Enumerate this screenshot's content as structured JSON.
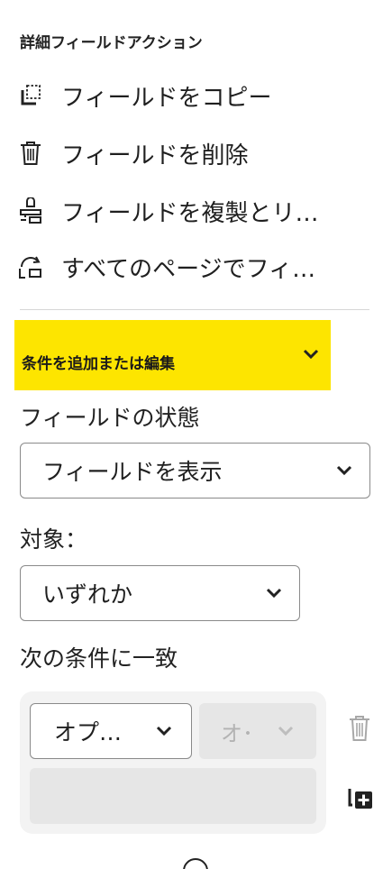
{
  "advanced_actions": {
    "heading": "詳細フィールドアクション",
    "items": [
      {
        "label": "フィールドをコピー",
        "icon": "copy-icon"
      },
      {
        "label": "フィールドを削除",
        "icon": "trash-icon"
      },
      {
        "label": "フィールドを複製とリ…",
        "icon": "duplicate-stamp-icon"
      },
      {
        "label": "すべてのページでフィ…",
        "icon": "all-pages-sync-icon"
      }
    ]
  },
  "conditions": {
    "header_label": "条件を追加または編集",
    "header_color": "#fde500",
    "field_state_label": "フィールドの状態",
    "field_state_value": "フィールドを表示",
    "target_label": "対象：",
    "target_value": "いずれか",
    "match_label": "次の条件に一致",
    "rule": {
      "operand_value": "オプ…",
      "operator_value": "オ･",
      "delete_icon": "trash-icon",
      "add_icon": "add-condition-icon"
    }
  }
}
